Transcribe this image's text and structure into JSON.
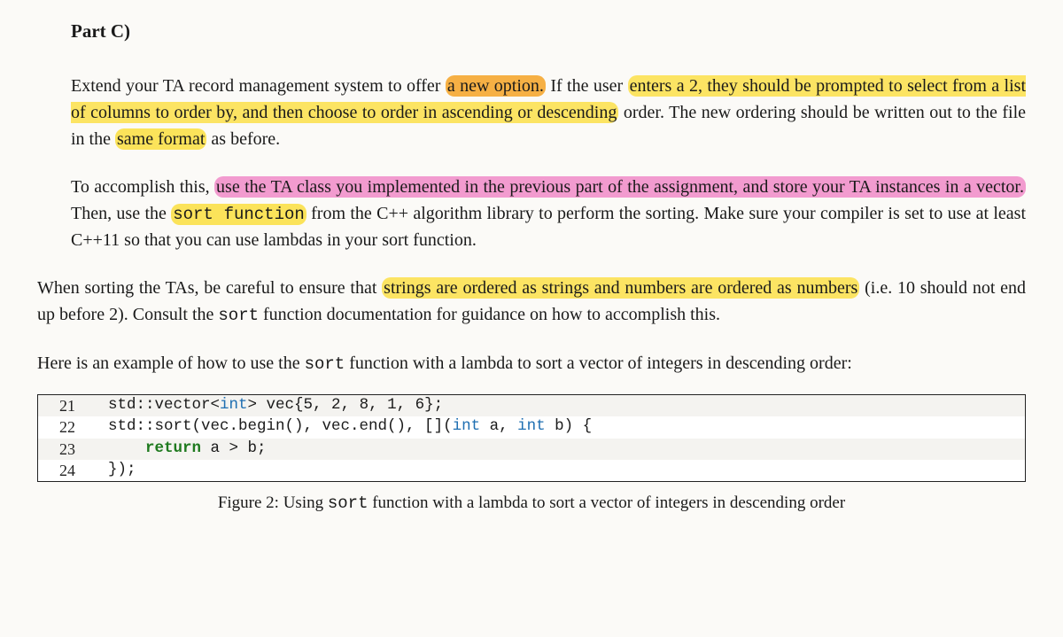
{
  "heading": "Part C)",
  "p1": {
    "a": "Extend your TA record management system to offer ",
    "hl1": "a new option.",
    "b": " If the user ",
    "hl2": "enters a 2, they should be prompted to select from a list of columns to order by, and then choose to order in ascending or descending",
    "c": " order. The new ordering should be written out to the file in the ",
    "hl3": "same format",
    "d": " as before."
  },
  "p2": {
    "a": "To accomplish this, ",
    "hl1": "use the TA class you implemented in the previous part of the assignment, and store your TA instances in a vector.",
    "b": " Then, use the ",
    "hl2": "sort function",
    "c": " from the C++ algorithm library to perform the sorting. Make sure your compiler is set to use at least C++11 so that you can use lambdas in your sort function."
  },
  "p3": {
    "a": "When sorting the TAs, be careful to ensure that ",
    "hl1": "strings are ordered as strings and numbers are ordered as numbers",
    "b": " (i.e. 10 should not end up before 2). Consult the ",
    "code": "sort",
    "c": " function documentation for guidance on how to accomplish this."
  },
  "p4": {
    "a": "Here is an example of how to use the ",
    "code": "sort",
    "b": " function with a lambda to sort a vector of integers in descending order:"
  },
  "code": {
    "l1": {
      "n": "21",
      "pre": "  std::vector<",
      "type": "int",
      "mid": "> vec{5, 2, 8, 1, 6};"
    },
    "l2": {
      "n": "22",
      "pre": "  std::sort(vec.begin(), vec.end(), [](",
      "t1": "int",
      "m1": " a, ",
      "t2": "int",
      "m2": " b) {"
    },
    "l3": {
      "n": "23",
      "pre": "      ",
      "kw": "return",
      "rest": " a > b;"
    },
    "l4": {
      "n": "24",
      "txt": "  });"
    }
  },
  "caption": {
    "a": "Figure 2: Using ",
    "code": "sort",
    "b": " function with a lambda to sort a vector of integers in descending order"
  }
}
